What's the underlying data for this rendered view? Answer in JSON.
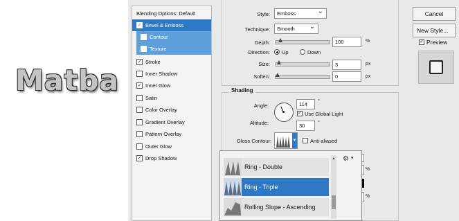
{
  "canvas": {
    "logo_text": "Matba"
  },
  "styles_list": {
    "items": [
      {
        "label": "Blending Options: Default",
        "checkbox": false,
        "checked": false,
        "selected": false,
        "sub": false
      },
      {
        "label": "Bevel & Emboss",
        "checkbox": true,
        "checked": true,
        "selected": true,
        "sub": false
      },
      {
        "label": "Contour",
        "checkbox": true,
        "checked": false,
        "selected": true,
        "sub": true
      },
      {
        "label": "Texture",
        "checkbox": true,
        "checked": false,
        "selected": true,
        "sub": true
      },
      {
        "label": "Stroke",
        "checkbox": true,
        "checked": true,
        "selected": false,
        "sub": false
      },
      {
        "label": "Inner Shadow",
        "checkbox": true,
        "checked": false,
        "selected": false,
        "sub": false
      },
      {
        "label": "Inner Glow",
        "checkbox": true,
        "checked": true,
        "selected": false,
        "sub": false
      },
      {
        "label": "Satin",
        "checkbox": true,
        "checked": false,
        "selected": false,
        "sub": false
      },
      {
        "label": "Color Overlay",
        "checkbox": true,
        "checked": false,
        "selected": false,
        "sub": false
      },
      {
        "label": "Gradient Overlay",
        "checkbox": true,
        "checked": false,
        "selected": false,
        "sub": false
      },
      {
        "label": "Pattern Overlay",
        "checkbox": true,
        "checked": false,
        "selected": false,
        "sub": false
      },
      {
        "label": "Outer Glow",
        "checkbox": true,
        "checked": false,
        "selected": false,
        "sub": false
      },
      {
        "label": "Drop Shadow",
        "checkbox": true,
        "checked": true,
        "selected": false,
        "sub": false
      }
    ]
  },
  "structure": {
    "style_label": "Style:",
    "style_value": "Emboss",
    "technique_label": "Technique:",
    "technique_value": "Smooth",
    "depth_label": "Depth:",
    "depth_value": "100",
    "depth_unit": "%",
    "direction_label": "Direction:",
    "direction_up": "Up",
    "direction_down": "Down",
    "direction_selected": "Up",
    "size_label": "Size:",
    "size_value": "3",
    "size_unit": "px",
    "soften_label": "Soften:",
    "soften_value": "0",
    "soften_unit": "px"
  },
  "shading": {
    "title": "Shading",
    "angle_label": "Angle:",
    "angle_value": "114",
    "angle_unit": "°",
    "global_light_label": "Use Global Light",
    "global_light_checked": true,
    "altitude_label": "Altitude:",
    "altitude_value": "30",
    "altitude_unit": "°",
    "gloss_label": "Gloss Contour:",
    "anti_aliased_label": "Anti-aliased",
    "anti_aliased_checked": false,
    "highlight_unit": "%",
    "shadow_unit": "%"
  },
  "contour_popup": {
    "items": [
      {
        "label": "Ring - Double",
        "selected": false
      },
      {
        "label": "Ring - Triple",
        "selected": true
      },
      {
        "label": "Rolling Slope - Ascending",
        "selected": false
      }
    ],
    "menu_icon": "gear-icon"
  },
  "buttons": {
    "cancel": "Cancel",
    "new_style": "New Style...",
    "preview_label": "Preview",
    "preview_checked": true
  },
  "colors": {
    "accent": "#2f78c6",
    "subaccent": "#5da0dc",
    "panel": "#e9e9e9"
  }
}
